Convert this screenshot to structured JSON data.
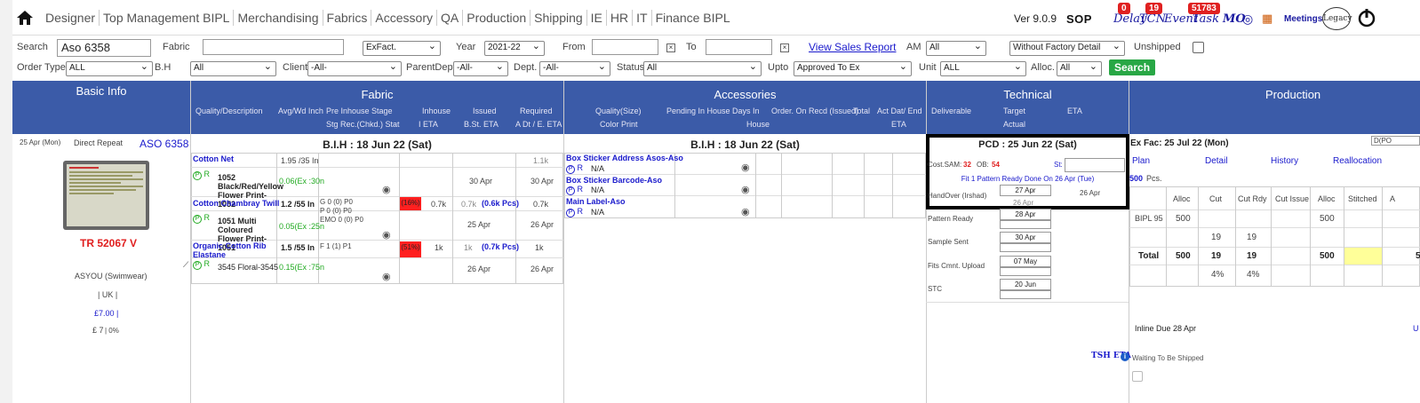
{
  "nav": {
    "items": [
      "Designer",
      "Top Management BIPL",
      "Merchandising",
      "Fabrics",
      "Accessory",
      "QA",
      "Production",
      "Shipping",
      "IE",
      "HR",
      "IT",
      "Finance BIPL"
    ],
    "version": "Ver 9.0.9",
    "sop": "SOP",
    "delay": "Delay",
    "delay_count": "0",
    "tcn": "TCN",
    "tcn_count": "19",
    "event": "Event",
    "task": "Task",
    "task_count": "51783",
    "mo": "MO",
    "meetings": "Meetings",
    "legacy": "Legacy"
  },
  "filters": {
    "search_label": "Search",
    "search_value": "Aso 6358",
    "fabric_label": "Fabric",
    "exfact": "ExFact.",
    "year_label": "Year",
    "year": "2021-22",
    "from_label": "From",
    "to_label": "To",
    "view_sales": "View Sales Report",
    "am_label": "AM",
    "am": "All",
    "factory": "Without Factory Detail",
    "unshipped": "Unshipped",
    "ordertype_label": "Order Type",
    "ordertype": "ALL",
    "bh_label": "B.H",
    "bh": "All",
    "client_label": "Client",
    "client": "-All-",
    "parent_label": "ParentDept.",
    "parent": "-All-",
    "dept_label": "Dept.",
    "dept": "-All-",
    "status_label": "Status",
    "status": "All",
    "upto_label": "Upto",
    "upto": "Approved To Ex",
    "unit_label": "Unit",
    "unit": "ALL",
    "alloc_label": "Alloc.",
    "alloc": "All",
    "search_btn": "Search"
  },
  "headers": {
    "basic": "Basic Info",
    "fabric": "Fabric",
    "fabric_sub1": [
      "Quality/Description",
      "Avg/Wd Inch",
      "Pre Inhouse Stage",
      "Inhouse",
      "Issued",
      "Required"
    ],
    "fabric_sub2": [
      "Stg Rec.(Chkd.) Stat",
      "I ETA",
      "B.St. ETA",
      "A Dt / E. ETA"
    ],
    "acc": "Accessories",
    "acc_sub1": [
      "Quality(Size)",
      "Pending In House Days",
      "In",
      "Order. On Recd (Issued)",
      "Total",
      "Act Dat/ End"
    ],
    "acc_sub2": [
      "Color Print",
      "House",
      "ETA"
    ],
    "tech": "Technical",
    "tech_sub": [
      "Deliverable",
      "Target",
      "ETA",
      "Actual"
    ],
    "prod": "Production"
  },
  "basic": {
    "date": "25 Apr (Mon)",
    "repeat": "Direct Repeat",
    "style": "ASO 6358",
    "tr": "TR 52067 V",
    "brand": "ASYOU (Swimwear)",
    "country": "| UK |",
    "price": "£7.00 |",
    "price2": "£ 7",
    "pct": "| 0%"
  },
  "fabric": {
    "bih": "B.I.H : 18 Jun 22 (Sat)",
    "rows": [
      {
        "name": "Cotton Net",
        "avg": "1.95 /35 In",
        "req": "1.1k",
        "desc": "1052 Black/Red/Yellow Flower Print-1052",
        "cons": "0.06(Ex :30n",
        "issued_eta": "30 Apr",
        "req_eta": "30 Apr"
      },
      {
        "name": "Cotton Chambray Twill",
        "avg": "1.2 /55 In",
        "stage": "G 0 (0) P0",
        "stage2": "P 0 (0) P0",
        "stage3": "EMO 0 (0) P0",
        "pct": "(16%)",
        "inh": "0.7k",
        "iss": "0.7k",
        "pcs": "(0.6k Pcs)",
        "req": "0.7k",
        "desc": "1051 Multi Coloured Flower Print-1051",
        "cons": "0.05(Ex :25n",
        "issued_eta": "25 Apr",
        "req_eta": "26 Apr"
      },
      {
        "name": "Organic Cotton Rib Elastane",
        "avg": "1.5 /55 In",
        "stage": "F 1 (1) P1",
        "pct": "(51%)",
        "inh": "1k",
        "iss": "1k",
        "pcs": "(0.7k Pcs)",
        "req": "1k",
        "desc": "3545 Floral-3545",
        "cons": "0.15(Ex :75n",
        "issued_eta": "26 Apr",
        "req_eta": "26 Apr"
      }
    ]
  },
  "acc": {
    "bih": "B.I.H : 18 Jun 22 (Sat)",
    "rows": [
      {
        "name": "Box Sticker Address Asos-Aso",
        "val": "N/A"
      },
      {
        "name": "Box Sticker Barcode-Aso",
        "val": "N/A"
      },
      {
        "name": "Main Label-Aso",
        "val": "N/A"
      }
    ]
  },
  "tech": {
    "pcd": "PCD : 25 Jun 22 (Sat)",
    "costsam_label": "Cost.SAM:",
    "costsam": "32",
    "ob_label": "OB:",
    "ob": "54",
    "st": "St:",
    "fit": "Fit 1 Pattern Ready Done On 26 Apr (Tue)",
    "rows": [
      {
        "label": "HandOver (Irshad)",
        "target": "27 Apr",
        "actual": "26 Apr",
        "eta": "26 Apr"
      },
      {
        "label": "Pattern Ready",
        "target": "28 Apr"
      },
      {
        "label": "Sample Sent",
        "target": "30 Apr"
      },
      {
        "label": "Fits Cmnt. Upload",
        "target": "07 May"
      },
      {
        "label": "STC",
        "target": "20 Jun"
      }
    ],
    "tsh": "TSH ETA"
  },
  "prod": {
    "exfac": "Ex Fac: 25 Jul 22 (Mon)",
    "dpo": "D(PO",
    "links": [
      "Plan",
      "Detail",
      "History",
      "Reallocation"
    ],
    "pcs": "500",
    "pcs_label": "Pcs.",
    "cols": [
      "Alloc",
      "Cut",
      "Cut Rdy",
      "Cut Issue",
      "Alloc",
      "Stitched",
      "A"
    ],
    "row1": {
      "unit": "BIPL 95",
      "alloc": "500",
      "alloc2": "500"
    },
    "row1b": {
      "cut": "19",
      "cutrdy": "19"
    },
    "total": {
      "label": "Total",
      "alloc": "500",
      "cut": "19",
      "cutrdy": "19",
      "alloc2": "500",
      "last": "5"
    },
    "pct": {
      "cut": "4%",
      "cutrdy": "4%"
    },
    "inline": "Inline Due 28 Apr",
    "u": "U",
    "waiting": "Waiting To Be Shipped"
  },
  "colors": {
    "header": "#3b5ba8",
    "accent": "#1a1acc",
    "alert": "#ff2020",
    "ok": "#28a745"
  }
}
